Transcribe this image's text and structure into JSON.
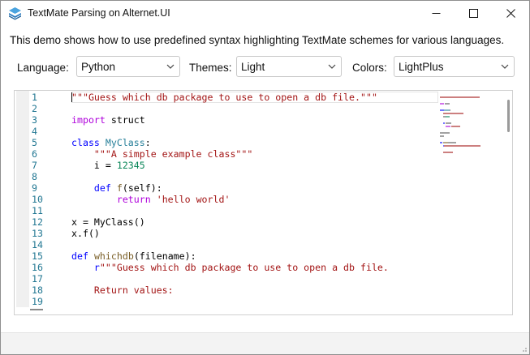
{
  "window": {
    "title": "TextMate Parsing on Alternet.UI",
    "minimize_glyph": "—",
    "maximize_glyph": "☐",
    "close_glyph": "✕"
  },
  "description": "This demo shows how to use predefined syntax highlighting TextMate schemes for various languages.",
  "toolbar": {
    "language_label": "Language:",
    "language_value": "Python",
    "themes_label": "Themes:",
    "themes_value": "Light",
    "colors_label": "Colors:",
    "colors_value": "LightPlus"
  },
  "editor": {
    "line_numbers": [
      "1",
      "2",
      "3",
      "4",
      "5",
      "6",
      "7",
      "8",
      "9",
      "10",
      "11",
      "12",
      "13",
      "14",
      "15",
      "16",
      "17",
      "18",
      "19"
    ],
    "code_lines": [
      [
        {
          "t": "\"\"\"Guess which db package to use to open a db file.\"\"\"",
          "c": "str"
        }
      ],
      [],
      [
        {
          "t": "import",
          "c": "ctl"
        },
        {
          "t": " struct",
          "c": "plain"
        }
      ],
      [],
      [
        {
          "t": "class",
          "c": "kw"
        },
        {
          "t": " ",
          "c": "plain"
        },
        {
          "t": "MyClass",
          "c": "cls"
        },
        {
          "t": ":",
          "c": "plain"
        }
      ],
      [
        {
          "t": "    ",
          "c": "plain"
        },
        {
          "t": "\"\"\"A simple example class\"\"\"",
          "c": "str"
        }
      ],
      [
        {
          "t": "    i = ",
          "c": "plain"
        },
        {
          "t": "12345",
          "c": "num"
        }
      ],
      [],
      [
        {
          "t": "    ",
          "c": "plain"
        },
        {
          "t": "def",
          "c": "kw"
        },
        {
          "t": " ",
          "c": "plain"
        },
        {
          "t": "f",
          "c": "fn"
        },
        {
          "t": "(self):",
          "c": "plain"
        }
      ],
      [
        {
          "t": "        ",
          "c": "plain"
        },
        {
          "t": "return",
          "c": "ctl"
        },
        {
          "t": " ",
          "c": "plain"
        },
        {
          "t": "'hello world'",
          "c": "str"
        }
      ],
      [],
      [
        {
          "t": "x = MyClass()",
          "c": "plain"
        }
      ],
      [
        {
          "t": "x.f()",
          "c": "plain"
        }
      ],
      [],
      [
        {
          "t": "def",
          "c": "kw"
        },
        {
          "t": " ",
          "c": "plain"
        },
        {
          "t": "whichdb",
          "c": "fn"
        },
        {
          "t": "(filename):",
          "c": "plain"
        }
      ],
      [
        {
          "t": "    ",
          "c": "plain"
        },
        {
          "t": "r",
          "c": "kw"
        },
        {
          "t": "\"\"\"Guess which db package to use to open a db file.",
          "c": "str"
        }
      ],
      [],
      [
        {
          "t": "    Return values:",
          "c": "str"
        }
      ],
      []
    ]
  },
  "colors": {
    "keyword": "#0000ff",
    "class_name": "#267f99",
    "function": "#795e26",
    "string": "#a31515",
    "number": "#098658",
    "control": "#af00db",
    "line_number": "#237893"
  }
}
